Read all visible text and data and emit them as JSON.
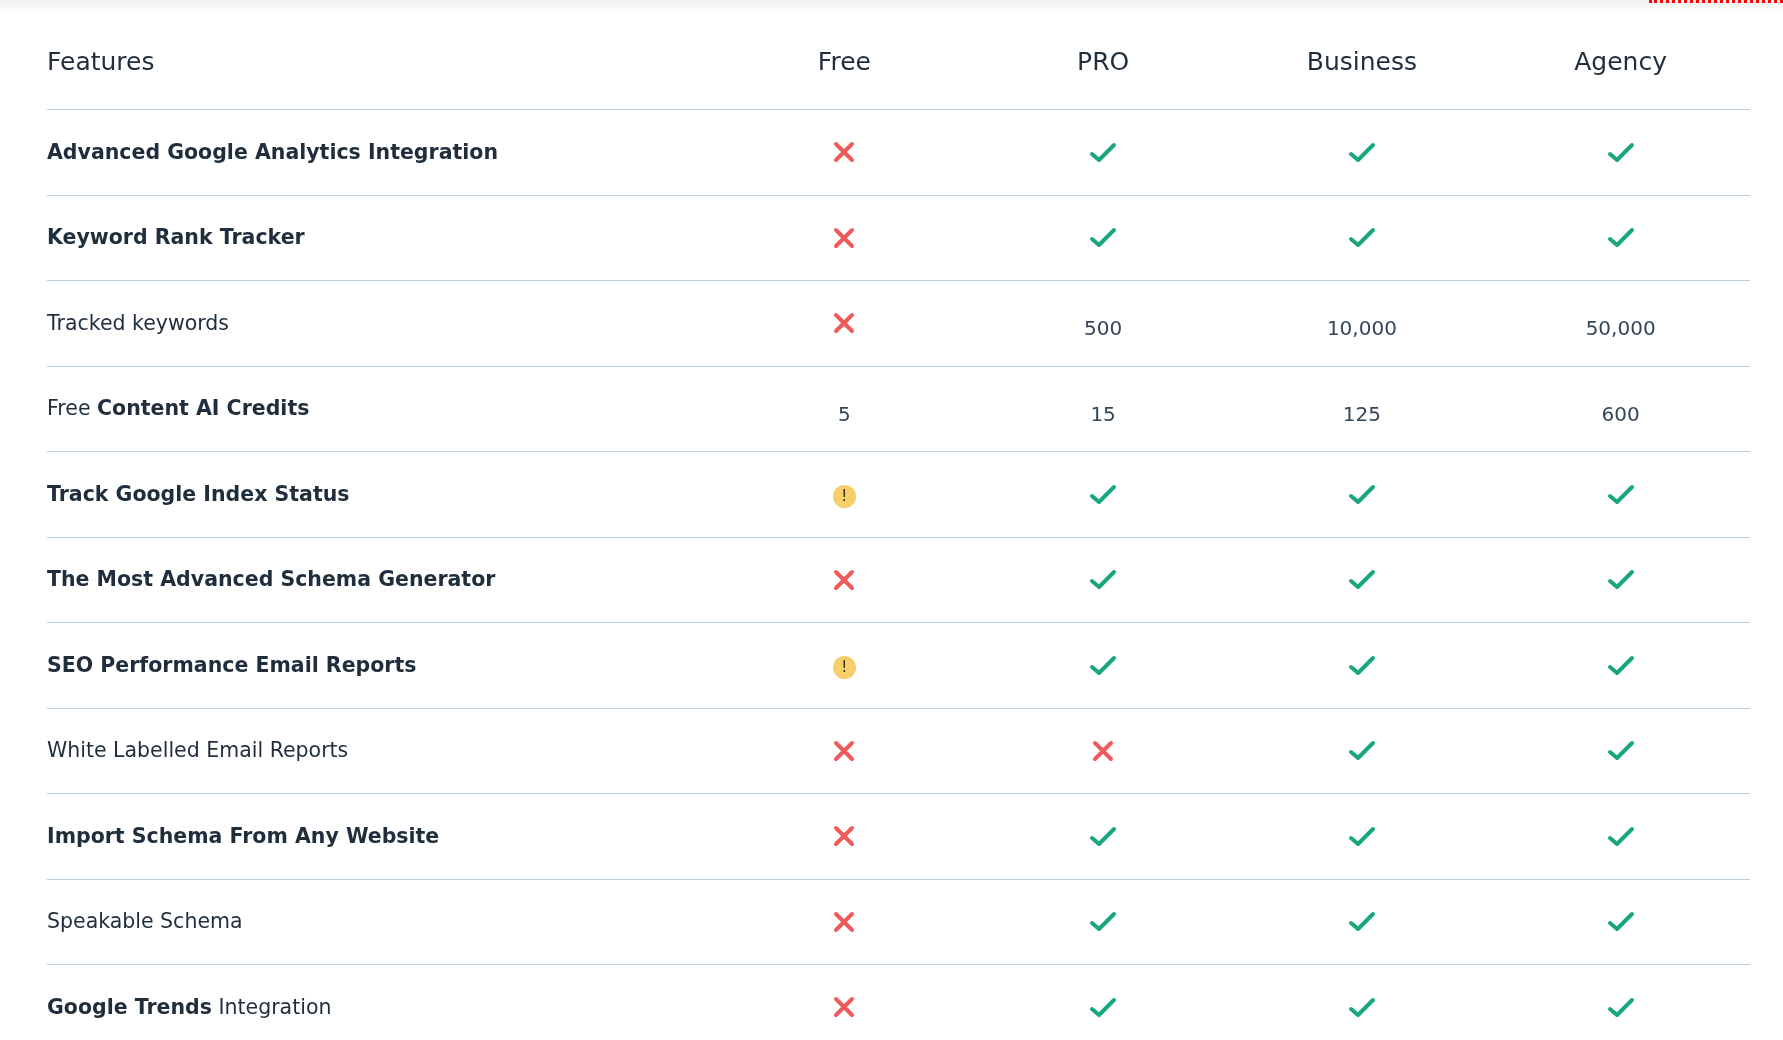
{
  "columns": [
    "Features",
    "Free",
    "PRO",
    "Business",
    "Agency"
  ],
  "rows": [
    {
      "feature": "Advanced Google Analytics Integration",
      "bold": true,
      "cells": [
        {
          "kind": "no"
        },
        {
          "kind": "yes"
        },
        {
          "kind": "yes"
        },
        {
          "kind": "yes"
        }
      ]
    },
    {
      "feature": "Keyword Rank Tracker",
      "bold": true,
      "cells": [
        {
          "kind": "no"
        },
        {
          "kind": "yes"
        },
        {
          "kind": "yes"
        },
        {
          "kind": "yes"
        }
      ]
    },
    {
      "feature": "Tracked keywords",
      "bold": false,
      "cells": [
        {
          "kind": "no"
        },
        {
          "kind": "text",
          "text": "500"
        },
        {
          "kind": "text",
          "text": "10,000"
        },
        {
          "kind": "text",
          "text": "50,000"
        }
      ]
    },
    {
      "feature": "Free **Content AI Credits**",
      "bold": false,
      "cells": [
        {
          "kind": "text",
          "text": "5"
        },
        {
          "kind": "text",
          "text": "15"
        },
        {
          "kind": "text",
          "text": "125"
        },
        {
          "kind": "text",
          "text": "600"
        }
      ]
    },
    {
      "feature": "Track Google Index Status",
      "bold": true,
      "cells": [
        {
          "kind": "partial",
          "text": "!"
        },
        {
          "kind": "yes"
        },
        {
          "kind": "yes"
        },
        {
          "kind": "yes"
        }
      ]
    },
    {
      "feature": "The Most Advanced Schema Generator",
      "bold": true,
      "cells": [
        {
          "kind": "no"
        },
        {
          "kind": "yes"
        },
        {
          "kind": "yes"
        },
        {
          "kind": "yes"
        }
      ]
    },
    {
      "feature": "SEO Performance Email Reports",
      "bold": true,
      "cells": [
        {
          "kind": "partial",
          "text": "!"
        },
        {
          "kind": "yes"
        },
        {
          "kind": "yes"
        },
        {
          "kind": "yes"
        }
      ]
    },
    {
      "feature": "White Labelled Email Reports",
      "bold": false,
      "cells": [
        {
          "kind": "no"
        },
        {
          "kind": "no"
        },
        {
          "kind": "yes"
        },
        {
          "kind": "yes"
        }
      ]
    },
    {
      "feature": "Import Schema From Any Website",
      "bold": true,
      "cells": [
        {
          "kind": "no"
        },
        {
          "kind": "yes"
        },
        {
          "kind": "yes"
        },
        {
          "kind": "yes"
        }
      ]
    },
    {
      "feature": "Speakable Schema",
      "bold": false,
      "cells": [
        {
          "kind": "no"
        },
        {
          "kind": "yes"
        },
        {
          "kind": "yes"
        },
        {
          "kind": "yes"
        }
      ]
    },
    {
      "feature": "**Google Trends** Integration",
      "bold": false,
      "cells": [
        {
          "kind": "no"
        },
        {
          "kind": "yes"
        },
        {
          "kind": "yes"
        },
        {
          "kind": "yes"
        }
      ]
    }
  ]
}
